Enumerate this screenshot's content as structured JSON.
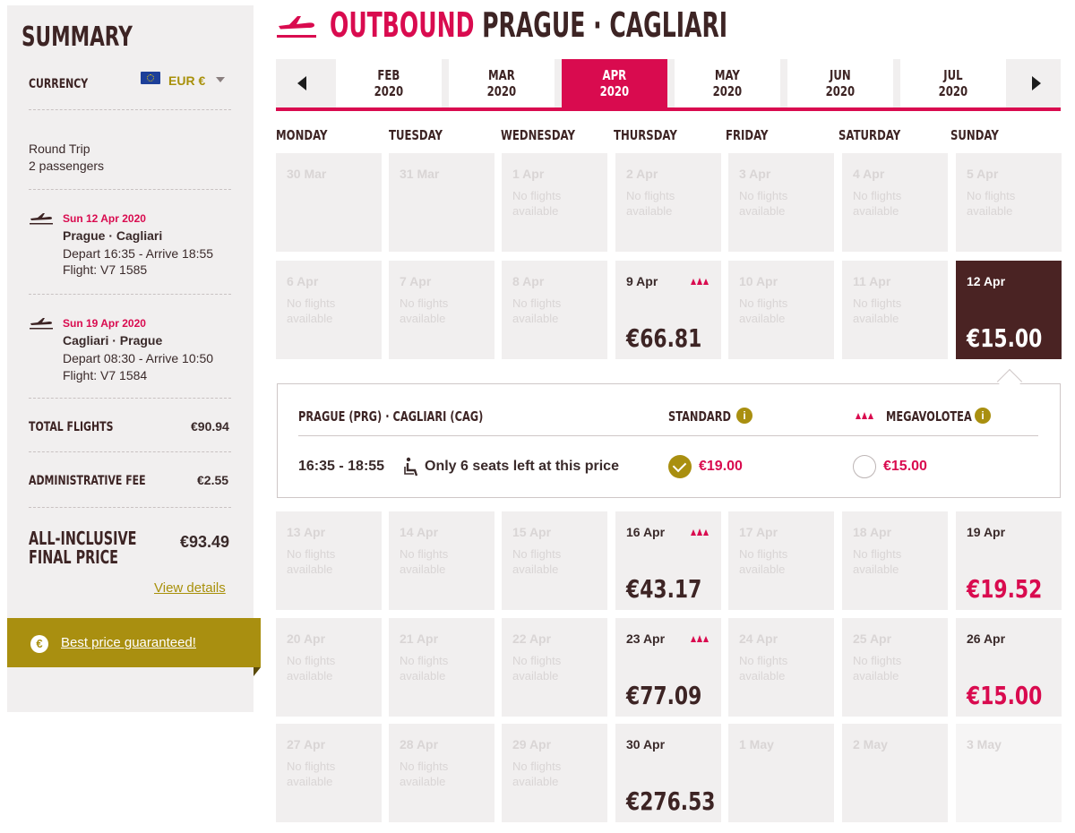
{
  "summary": {
    "title": "SUMMARY",
    "currency_label": "CURRENCY",
    "currency_value": "EUR €",
    "trip_type": "Round Trip",
    "passengers": "2 passengers",
    "legs": [
      {
        "date": "Sun 12 Apr 2020",
        "route": "Prague · Cagliari",
        "times": "Depart 16:35 - Arrive 18:55",
        "flight": "Flight: V7 1585"
      },
      {
        "date": "Sun 19 Apr 2020",
        "route": "Cagliari · Prague",
        "times": "Depart 08:30 - Arrive 10:50",
        "flight": "Flight: V7 1584"
      }
    ],
    "total_flights_label": "TOTAL FLIGHTS",
    "total_flights_value": "€90.94",
    "admin_fee_label": "ADMINISTRATIVE FEE",
    "admin_fee_value": "€2.55",
    "final_label_1": "ALL-INCLUSIVE",
    "final_label_2": "FINAL PRICE",
    "final_value": "€93.49",
    "view_details": "View details",
    "best_price": "Best price guaranteed!",
    "euro_symbol": "€"
  },
  "header": {
    "outbound_word": "OUTBOUND",
    "route": "PRAGUE · CAGLIARI"
  },
  "months": [
    {
      "m": "FEB",
      "y": "2020"
    },
    {
      "m": "MAR",
      "y": "2020"
    },
    {
      "m": "APR",
      "y": "2020",
      "active": true
    },
    {
      "m": "MAY",
      "y": "2020"
    },
    {
      "m": "JUN",
      "y": "2020"
    },
    {
      "m": "JUL",
      "y": "2020"
    }
  ],
  "weekdays": [
    "MONDAY",
    "TUESDAY",
    "WEDNESDAY",
    "THURSDAY",
    "FRIDAY",
    "SATURDAY",
    "SUNDAY"
  ],
  "no_flights_text": "No flights available",
  "weeks": [
    [
      {
        "date": "30 Mar",
        "status": "dim"
      },
      {
        "date": "31 Mar",
        "status": "dim"
      },
      {
        "date": "1 Apr",
        "status": "dim",
        "na": true
      },
      {
        "date": "2 Apr",
        "status": "dim",
        "na": true
      },
      {
        "date": "3 Apr",
        "status": "dim",
        "na": true
      },
      {
        "date": "4 Apr",
        "status": "dim",
        "na": true
      },
      {
        "date": "5 Apr",
        "status": "dim",
        "na": true
      }
    ],
    [
      {
        "date": "6 Apr",
        "status": "dim",
        "na": true
      },
      {
        "date": "7 Apr",
        "status": "dim",
        "na": true
      },
      {
        "date": "8 Apr",
        "status": "dim",
        "na": true
      },
      {
        "date": "9 Apr",
        "status": "avail",
        "price": "€66.81",
        "mega": true
      },
      {
        "date": "10 Apr",
        "status": "dim",
        "na": true
      },
      {
        "date": "11 Apr",
        "status": "dim",
        "na": true
      },
      {
        "date": "12 Apr",
        "status": "selected",
        "price": "€15.00"
      }
    ],
    [
      {
        "date": "13 Apr",
        "status": "dim",
        "na": true
      },
      {
        "date": "14 Apr",
        "status": "dim",
        "na": true
      },
      {
        "date": "15 Apr",
        "status": "dim",
        "na": true
      },
      {
        "date": "16 Apr",
        "status": "avail",
        "price": "€43.17",
        "mega": true
      },
      {
        "date": "17 Apr",
        "status": "dim",
        "na": true
      },
      {
        "date": "18 Apr",
        "status": "dim",
        "na": true
      },
      {
        "date": "19 Apr",
        "status": "avail",
        "price": "€19.52",
        "red": true
      }
    ],
    [
      {
        "date": "20 Apr",
        "status": "dim",
        "na": true
      },
      {
        "date": "21 Apr",
        "status": "dim",
        "na": true
      },
      {
        "date": "22 Apr",
        "status": "dim",
        "na": true
      },
      {
        "date": "23 Apr",
        "status": "avail",
        "price": "€77.09",
        "mega": true
      },
      {
        "date": "24 Apr",
        "status": "dim",
        "na": true
      },
      {
        "date": "25 Apr",
        "status": "dim",
        "na": true
      },
      {
        "date": "26 Apr",
        "status": "avail",
        "price": "€15.00",
        "red": true
      }
    ],
    [
      {
        "date": "27 Apr",
        "status": "dim",
        "na": true
      },
      {
        "date": "28 Apr",
        "status": "dim",
        "na": true
      },
      {
        "date": "29 Apr",
        "status": "dim",
        "na": true
      },
      {
        "date": "30 Apr",
        "status": "avail",
        "price": "€276.53"
      },
      {
        "date": "1 May",
        "status": "dim"
      },
      {
        "date": "2 May",
        "status": "dim"
      },
      {
        "date": "3 May",
        "status": "dim",
        "blank": true
      }
    ]
  ],
  "detail": {
    "route": "PRAGUE (PRG) · CAGLIARI (CAG)",
    "standard_label": "STANDARD",
    "mega_label": "MEGAVOLOTEA",
    "info_glyph": "i",
    "time": "16:35 - 18:55",
    "seats": "Only 6 seats left at this price",
    "standard_price": "€19.00",
    "mega_price": "€15.00"
  },
  "colors": {
    "brand_red": "#d90b4f",
    "brand_gold": "#a98f10",
    "dark_brown": "#4a2323",
    "cell_bg": "#f1efef"
  },
  "icons": {
    "plane": "plane-takeoff-icon",
    "mega": "megavolotea-icon",
    "info": "info-icon",
    "seat": "wheelchair-seat-icon"
  }
}
